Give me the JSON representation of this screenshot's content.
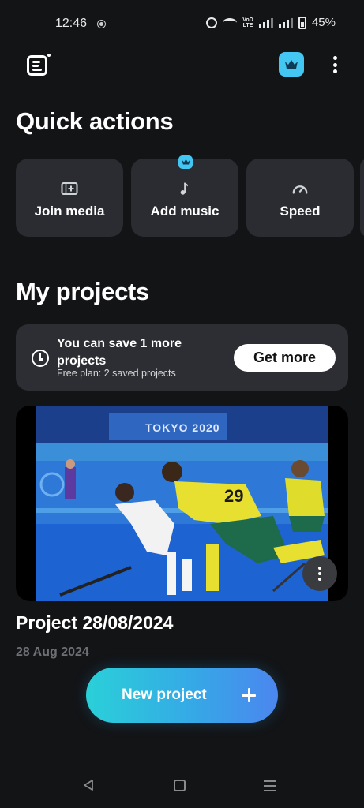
{
  "status_bar": {
    "time": "12:46",
    "network_label": "VoD LTE",
    "battery": "45%",
    "icons": [
      "alarm-icon",
      "wifi-icon",
      "volte-icon",
      "signal-icon",
      "signal-icon",
      "battery-icon"
    ]
  },
  "header": {
    "menu_icon": "project-list-icon",
    "premium_icon": "crown-icon",
    "more_icon": "more-vertical-icon"
  },
  "quick_actions": {
    "title": "Quick actions",
    "items": [
      {
        "label": "Join media",
        "icon": "add-media-icon",
        "premium": false
      },
      {
        "label": "Add music",
        "icon": "music-note-icon",
        "premium": true
      },
      {
        "label": "Speed",
        "icon": "speedometer-icon",
        "premium": false
      }
    ]
  },
  "my_projects": {
    "title": "My projects",
    "banner": {
      "title": "You can save 1 more projects",
      "subtitle": "Free plan: 2 saved projects",
      "button": "Get more",
      "icon": "clock-icon"
    },
    "projects": [
      {
        "name": "Project 28/08/2024",
        "date": "28 Aug 2024",
        "thumbnail_text": "TOKYO 2020",
        "thumbnail_number": "29"
      }
    ]
  },
  "new_project": {
    "label": "New project",
    "icon": "plus-icon"
  },
  "nav_bar": {
    "icons": [
      "back-icon",
      "home-icon",
      "recents-icon"
    ]
  },
  "colors": {
    "background": "#131416",
    "card": "#2a2c31",
    "accent": "#43c6f2",
    "gradient_start": "#2ad0d8",
    "gradient_end": "#4b86ef"
  }
}
